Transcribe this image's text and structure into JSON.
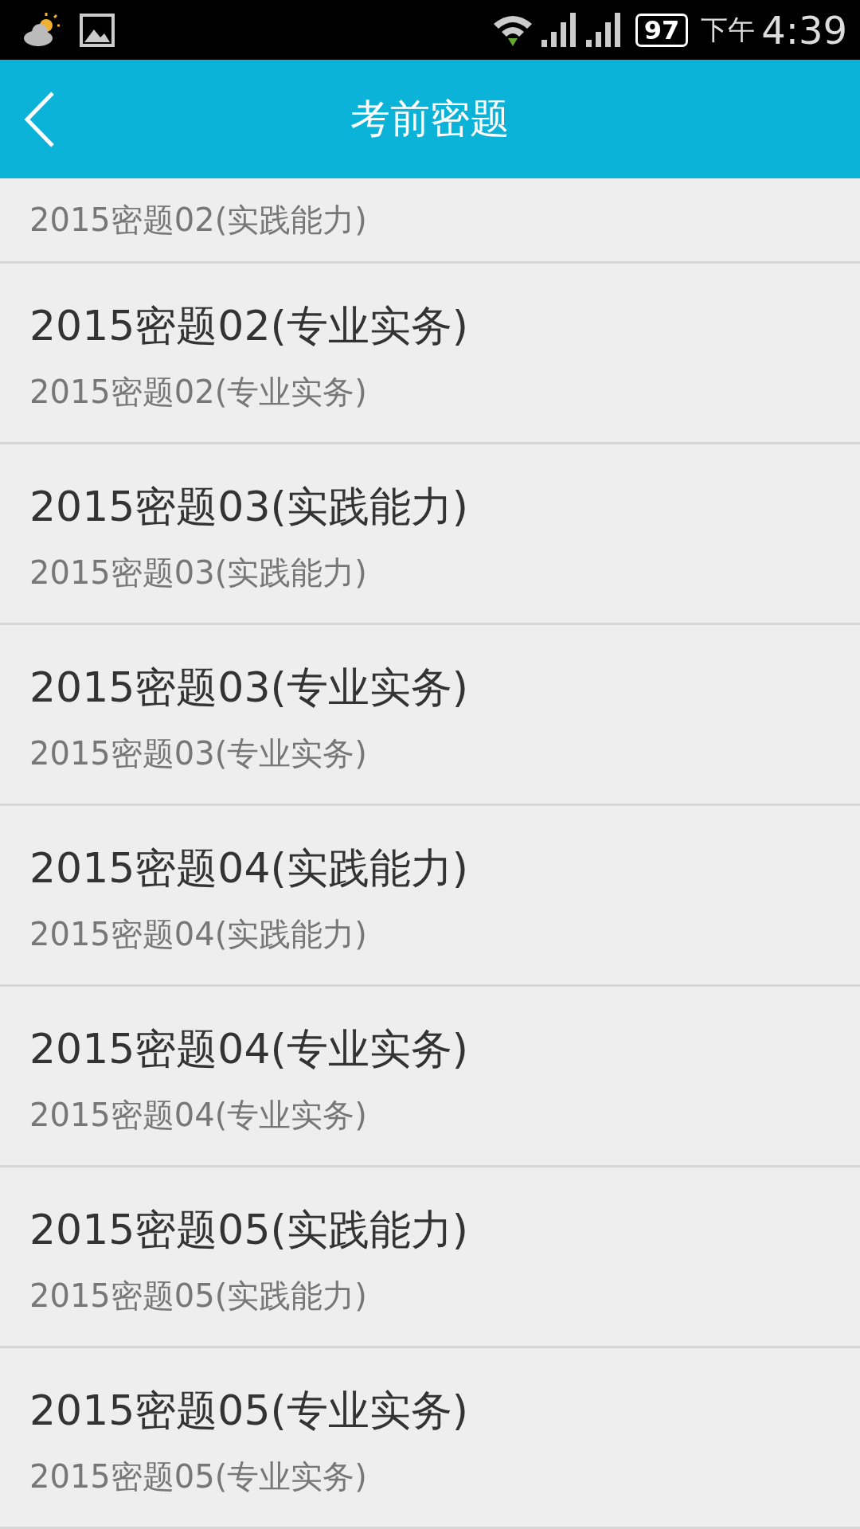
{
  "status_bar": {
    "battery": "97",
    "period": "下午",
    "time": "4:39"
  },
  "header": {
    "title": "考前密题"
  },
  "items": [
    {
      "subtitle": "2015密题02(实践能力)"
    },
    {
      "title": "2015密题02(专业实务)",
      "subtitle": "2015密题02(专业实务)"
    },
    {
      "title": "2015密题03(实践能力)",
      "subtitle": "2015密题03(实践能力)"
    },
    {
      "title": "2015密题03(专业实务)",
      "subtitle": "2015密题03(专业实务)"
    },
    {
      "title": "2015密题04(实践能力)",
      "subtitle": "2015密题04(实践能力)"
    },
    {
      "title": "2015密题04(专业实务)",
      "subtitle": "2015密题04(专业实务)"
    },
    {
      "title": "2015密题05(实践能力)",
      "subtitle": "2015密题05(实践能力)"
    },
    {
      "title": "2015密题05(专业实务)",
      "subtitle": "2015密题05(专业实务)"
    }
  ]
}
